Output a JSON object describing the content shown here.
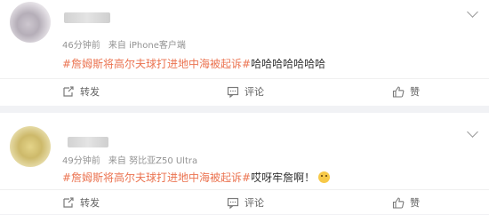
{
  "posts": [
    {
      "time": "46分钟前",
      "source": "来自 iPhone客户端",
      "hashtag": "#詹姆斯将高尔夫球打进地中海被起诉#",
      "text": "哈哈哈哈哈哈哈",
      "has_emoji": false,
      "actions": {
        "repost": "转发",
        "comment": "评论",
        "like": "赞"
      }
    },
    {
      "time": "49分钟前",
      "source": "来自 努比亚Z50 Ultra",
      "hashtag": "#詹姆斯将高尔夫球打进地中海被起诉#",
      "text": "哎呀牢詹啊！",
      "has_emoji": true,
      "actions": {
        "repost": "转发",
        "comment": "评论",
        "like": "赞"
      }
    }
  ],
  "icons": [
    "repost-icon",
    "comment-icon",
    "like-icon",
    "chevron-down-icon",
    "emoji-icon"
  ],
  "colors": {
    "hashtag": "#eb7350",
    "background": "#f1f2f5",
    "card": "#ffffff"
  }
}
